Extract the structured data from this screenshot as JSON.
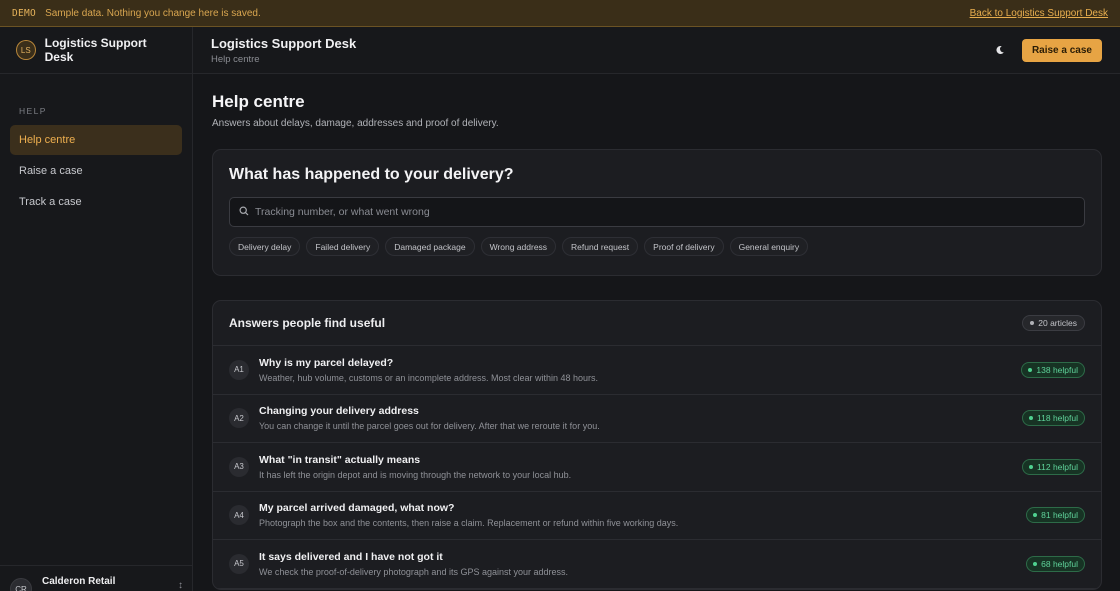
{
  "banner": {
    "tag": "DEMO",
    "message": "Sample data. Nothing you change here is saved.",
    "back_link": "Back to Logistics Support Desk"
  },
  "sidebar": {
    "brand_initials": "LS",
    "brand_name": "Logistics Support Desk",
    "section_heading": "HELP",
    "items": [
      {
        "label": "Help centre",
        "active": true
      },
      {
        "label": "Raise a case",
        "active": false
      },
      {
        "label": "Track a case",
        "active": false
      }
    ],
    "user": {
      "initials": "CR",
      "name": "Calderon Retail"
    }
  },
  "topbar": {
    "title": "Logistics Support Desk",
    "subtitle": "Help centre",
    "theme_icon": "moon-icon",
    "raise_button": "Raise a case"
  },
  "main": {
    "title": "Help centre",
    "subtitle": "Answers about delays, damage, addresses and proof of delivery."
  },
  "search": {
    "question": "What has happened to your delivery?",
    "placeholder": "Tracking number, or what went wrong",
    "chips": [
      "Delivery delay",
      "Failed delivery",
      "Damaged package",
      "Wrong address",
      "Refund request",
      "Proof of delivery",
      "General enquiry"
    ]
  },
  "answers": {
    "title": "Answers people find useful",
    "count": "20 articles",
    "rows": [
      {
        "id": "A1",
        "title": "Why is my parcel delayed?",
        "desc": "Weather, hub volume, customs or an incomplete address. Most clear within 48 hours.",
        "helpful": "138 helpful"
      },
      {
        "id": "A2",
        "title": "Changing your delivery address",
        "desc": "You can change it until the parcel goes out for delivery. After that we reroute it for you.",
        "helpful": "118 helpful"
      },
      {
        "id": "A3",
        "title": "What \"in transit\" actually means",
        "desc": "It has left the origin depot and is moving through the network to your local hub.",
        "helpful": "112 helpful"
      },
      {
        "id": "A4",
        "title": "My parcel arrived damaged, what now?",
        "desc": "Photograph the box and the contents, then raise a claim. Replacement or refund within five working days.",
        "helpful": "81 helpful"
      },
      {
        "id": "A5",
        "title": "It says delivered and I have not got it",
        "desc": "We check the proof-of-delivery photograph and its GPS against your address.",
        "helpful": "68 helpful"
      }
    ]
  },
  "colors": {
    "accent": "#e7a444",
    "background": "#151619",
    "card": "#1c1d21",
    "helpful_green": "#5fd39a"
  }
}
